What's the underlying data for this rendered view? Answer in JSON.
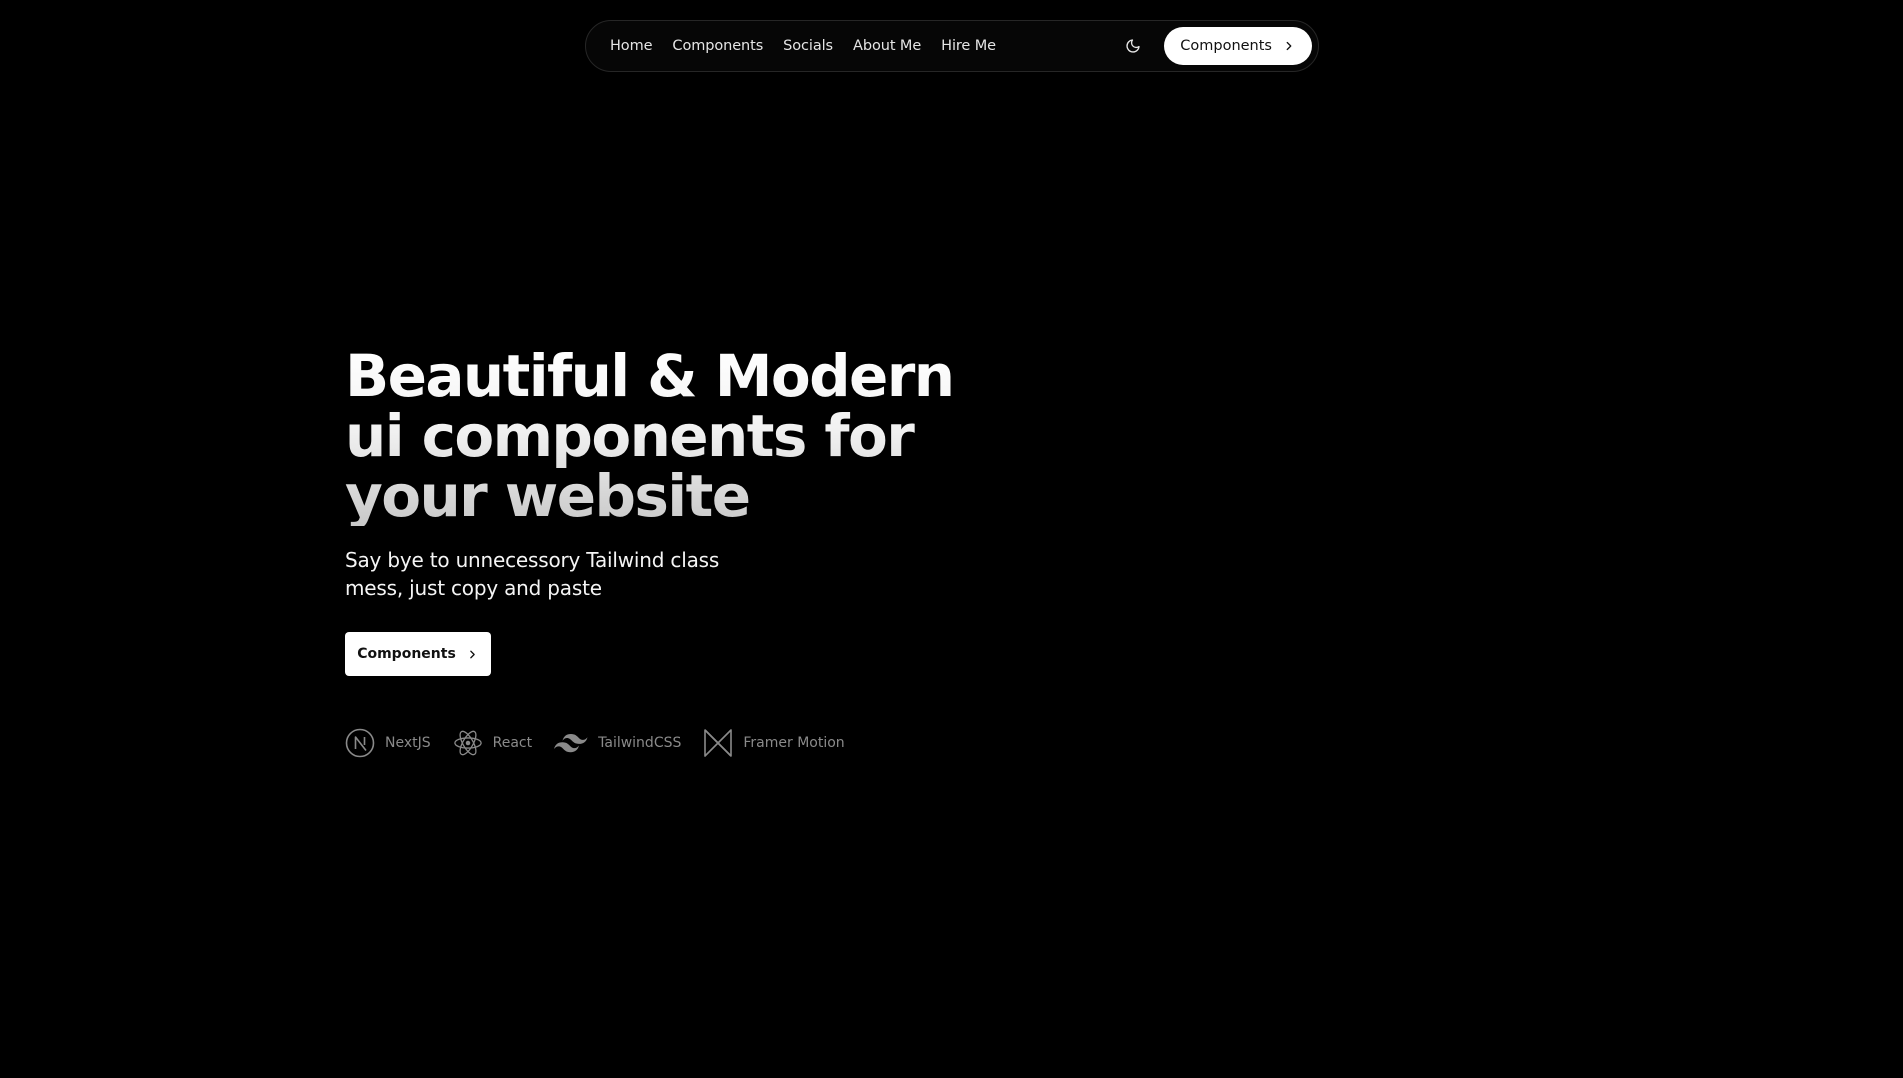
{
  "nav": {
    "links": [
      {
        "label": "Home"
      },
      {
        "label": "Components"
      },
      {
        "label": "Socials"
      },
      {
        "label": "About Me"
      },
      {
        "label": "Hire Me"
      }
    ],
    "theme_toggle_icon": "moon-icon",
    "cta_label": "Components",
    "cta_icon": "chevron-right-icon"
  },
  "hero": {
    "title_lines": [
      "Beautiful & Modern",
      "ui components for",
      "your website"
    ],
    "subtitle_lines": [
      "Say bye to unnecessory Tailwind class",
      "mess, just copy and paste"
    ],
    "cta_label": "Components",
    "cta_icon": "chevron-right-icon"
  },
  "tech": [
    {
      "label": "NextJS",
      "icon": "nextjs-icon"
    },
    {
      "label": "React",
      "icon": "react-icon"
    },
    {
      "label": "TailwindCSS",
      "icon": "tailwind-icon"
    },
    {
      "label": "Framer Motion",
      "icon": "framer-motion-icon"
    }
  ],
  "colors": {
    "background": "#000000",
    "nav_border": "#262626",
    "button_bg": "#ffffff",
    "muted_text": "#8a8a8a"
  }
}
